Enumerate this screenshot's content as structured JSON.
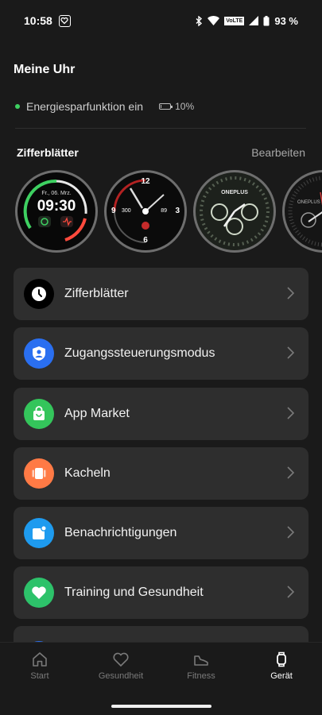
{
  "status_bar": {
    "time": "10:58",
    "battery": "93 %",
    "network": "VoLTE"
  },
  "page_title": "Meine Uhr",
  "energy": {
    "label": "Energiesparfunktion ein",
    "battery": "10%",
    "battery_level": 0.1,
    "status_color": "#3ed061"
  },
  "watch_faces": {
    "title": "Zifferblätter",
    "edit": "Bearbeiten",
    "items": [
      {
        "date": "Fr., 06. Mrz.",
        "time": "09:30"
      },
      {
        "left": "300",
        "right": "89",
        "top": "12",
        "bottom": "6",
        "l": "9",
        "r": "3"
      },
      {
        "brand": "ONEPLUS"
      },
      {
        "brand": "ONEPLUS"
      }
    ]
  },
  "menu": [
    {
      "label": "Zifferblätter",
      "icon": "clock-icon",
      "color": "#000000"
    },
    {
      "label": "Zugangssteuerungsmodus",
      "icon": "user-shield-icon",
      "color": "#2a6ff0"
    },
    {
      "label": "App Market",
      "icon": "shopping-bag-icon",
      "color": "#34c55b"
    },
    {
      "label": "Kacheln",
      "icon": "tiles-icon",
      "color": "#ff7a45"
    },
    {
      "label": "Benachrichtigungen",
      "icon": "notification-icon",
      "color": "#1e9bef"
    },
    {
      "label": "Training und Gesundheit",
      "icon": "heart-icon",
      "color": "#2dc26a"
    }
  ],
  "bottom_nav": [
    {
      "label": "Start",
      "icon": "home-icon",
      "active": false
    },
    {
      "label": "Gesundheit",
      "icon": "heart-outline-icon",
      "active": false
    },
    {
      "label": "Fitness",
      "icon": "shoe-icon",
      "active": false
    },
    {
      "label": "Gerät",
      "icon": "watch-icon",
      "active": true
    }
  ]
}
